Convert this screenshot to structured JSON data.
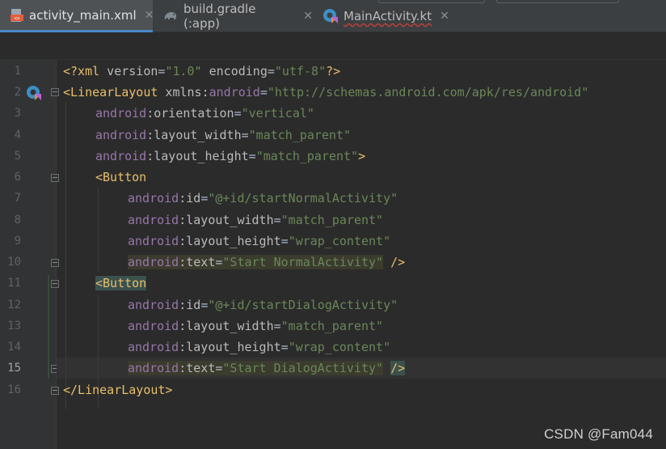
{
  "tabs": [
    {
      "label": "activity_main.xml",
      "icon": "xml-file-icon",
      "active": true
    },
    {
      "label": "build.gradle (:app)",
      "icon": "gradle-elephant-icon",
      "active": false
    },
    {
      "label": "MainActivity.kt",
      "icon": "kotlin-class-icon",
      "active": false
    }
  ],
  "close_glyph": "✕",
  "line_numbers": [
    "1",
    "2",
    "3",
    "4",
    "5",
    "6",
    "7",
    "8",
    "9",
    "10",
    "11",
    "12",
    "13",
    "14",
    "15",
    "16"
  ],
  "current_line": "15",
  "code": {
    "l1": {
      "pi_open": "<?xml",
      "a1": " version",
      "eq1": "=",
      "v1": "\"1.0\"",
      "a2": " encoding",
      "eq2": "=",
      "v2": "\"utf-8\"",
      "pi_close": "?>"
    },
    "l2": {
      "open": "<LinearLayout",
      "sp": " xmlns",
      "colon": ":",
      "ns": "android",
      "eq": "=",
      "v": "\"http://schemas.android.com/apk/res/android\""
    },
    "l3": {
      "ns": "android",
      "colon": ":",
      "attr": "orientation",
      "eq": "=",
      "v": "\"vertical\""
    },
    "l4": {
      "ns": "android",
      "colon": ":",
      "attr": "layout_width",
      "eq": "=",
      "v": "\"match_parent\""
    },
    "l5": {
      "ns": "android",
      "colon": ":",
      "attr": "layout_height",
      "eq": "=",
      "v": "\"match_parent\"",
      "close": ">"
    },
    "l6": {
      "open": "<Button"
    },
    "l7": {
      "ns": "android",
      "colon": ":",
      "attr": "id",
      "eq": "=",
      "v": "\"@+id/startNormalActivity\""
    },
    "l8": {
      "ns": "android",
      "colon": ":",
      "attr": "layout_width",
      "eq": "=",
      "v": "\"match_parent\""
    },
    "l9": {
      "ns": "android",
      "colon": ":",
      "attr": "layout_height",
      "eq": "=",
      "v": "\"wrap_content\""
    },
    "l10": {
      "ns": "android",
      "colon": ":",
      "attr": "text",
      "eq": "=",
      "v": "\"Start NormalActivity\"",
      "close": " />"
    },
    "l11": {
      "open": "<Button"
    },
    "l12": {
      "ns": "android",
      "colon": ":",
      "attr": "id",
      "eq": "=",
      "v": "\"@+id/startDialogActivity\""
    },
    "l13": {
      "ns": "android",
      "colon": ":",
      "attr": "layout_width",
      "eq": "=",
      "v": "\"match_parent\""
    },
    "l14": {
      "ns": "android",
      "colon": ":",
      "attr": "layout_height",
      "eq": "=",
      "v": "\"wrap_content\""
    },
    "l15": {
      "ns": "android",
      "colon": ":",
      "attr": "text",
      "eq": "=",
      "v": "\"Start DialogActivity\"",
      "sp": " ",
      "close": "/>"
    },
    "l16": {
      "close": "</LinearLayout>"
    }
  },
  "watermark": "CSDN @Fam044",
  "colors": {
    "tag": "#e8bf6a",
    "namespace": "#9876aa",
    "attribute": "#bababa",
    "string": "#6a8759",
    "background": "#2b2b2b",
    "gutter": "#313335",
    "active_tab_underline": "#4a88c7"
  }
}
